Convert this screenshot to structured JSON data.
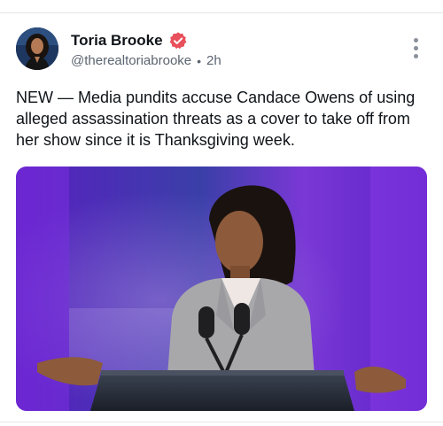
{
  "post": {
    "author_name": "Toria Brooke",
    "handle": "@therealtoriabrooke",
    "separator": "•",
    "time": "2h",
    "text": "NEW — Media pundits accuse Candace Owens of using alleged assassination threats as a cover to take off from her show since it is Thanksgiving week."
  },
  "icons": {
    "verified": "verified-badge-icon",
    "more": "more-vertical-icon"
  },
  "colors": {
    "verified_badge": "#e8505b",
    "stage_purple": "#6a2bd8",
    "text_primary": "#0f1419",
    "text_secondary": "#5b6470"
  }
}
